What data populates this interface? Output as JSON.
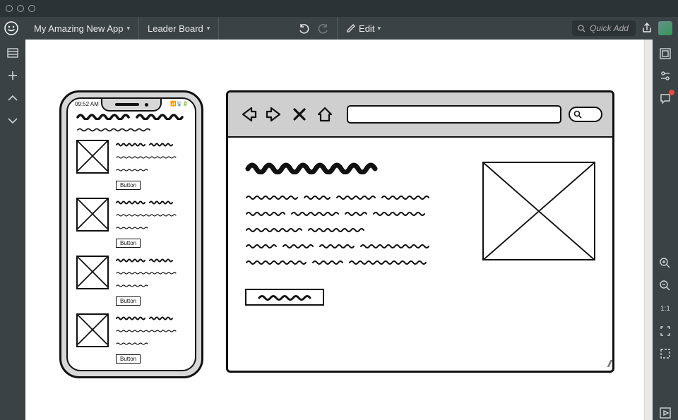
{
  "app": {
    "project_name": "My Amazing New App",
    "page_name": "Leader Board",
    "edit_label": "Edit",
    "quick_add_placeholder": "Quick Add"
  },
  "left_rail": {
    "items": [
      "panel-toggle",
      "add",
      "collapse-up",
      "expand-down"
    ]
  },
  "right_rail": {
    "top": [
      "inspector",
      "settings",
      "comments"
    ],
    "zoom": {
      "in": "zoom-in",
      "out": "zoom-out",
      "actual": "1:1",
      "fit": "fit",
      "fullscreen": "fullscreen"
    }
  },
  "canvas": {
    "phone": {
      "time": "09:52 AM",
      "status_right": "📶 📡 🔋",
      "list": [
        {
          "button": "Button"
        },
        {
          "button": "Button"
        },
        {
          "button": "Button"
        },
        {
          "button": "Button"
        }
      ]
    },
    "browser": {
      "nav": [
        "back",
        "forward",
        "stop",
        "home"
      ],
      "cta": "button"
    }
  }
}
